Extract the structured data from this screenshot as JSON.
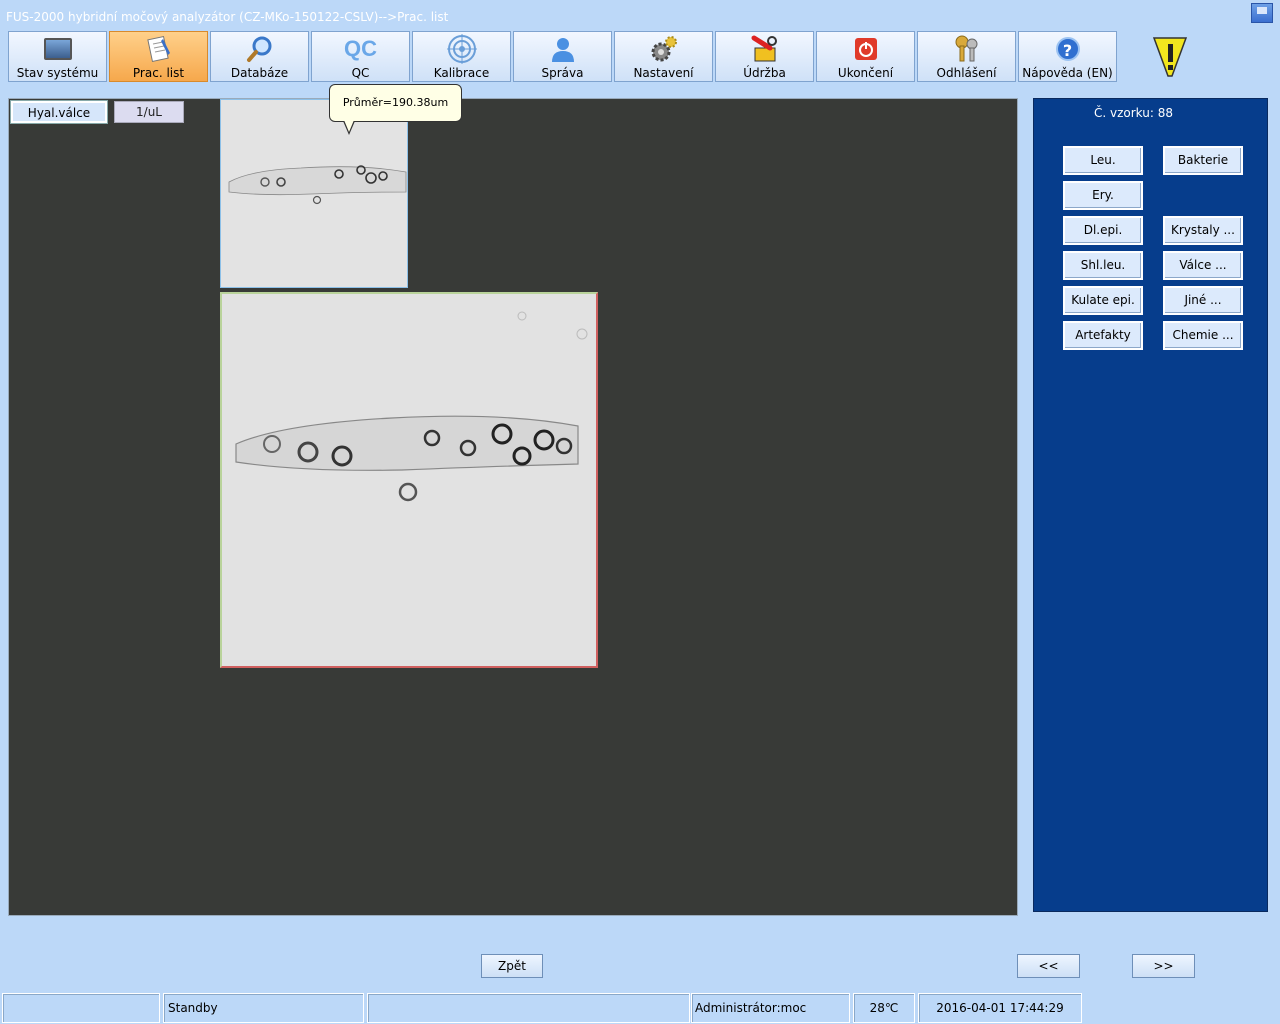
{
  "window": {
    "title": "FUS-2000 hybridní močový analyzátor (CZ-MKo-150122-CSLV)-->Prac. list"
  },
  "toolbar": {
    "items": [
      {
        "label": "Stav systému",
        "icon": "monitor-icon",
        "active": false
      },
      {
        "label": "Prac. list",
        "icon": "worklist-icon",
        "active": true
      },
      {
        "label": "Databáze",
        "icon": "magnifier-icon",
        "active": false
      },
      {
        "label": "QC",
        "icon": "qc-icon",
        "active": false
      },
      {
        "label": "Kalibrace",
        "icon": "target-icon",
        "active": false
      },
      {
        "label": "Správa",
        "icon": "user-icon",
        "active": false
      },
      {
        "label": "Nastavení",
        "icon": "gears-icon",
        "active": false
      },
      {
        "label": "Údržba",
        "icon": "toolbox-icon",
        "active": false
      },
      {
        "label": "Ukončení",
        "icon": "power-icon",
        "active": false
      },
      {
        "label": "Odhlášení",
        "icon": "keys-icon",
        "active": false
      },
      {
        "label": "Nápověda (EN)",
        "icon": "help-icon",
        "active": false
      }
    ],
    "qc_glyph": "QC",
    "help_glyph": "?"
  },
  "viewer": {
    "class_tag": "Hyal.válce",
    "unit_tag": "1/uL",
    "tooltip": "Průměr=190.38um"
  },
  "side": {
    "sample_label": "Č. vzorku: 88",
    "buttons": [
      {
        "label": "Leu."
      },
      {
        "label": "Bakterie"
      },
      {
        "label": "Ery."
      },
      {
        "label": "Dl.epi."
      },
      {
        "label": "Krystaly ..."
      },
      {
        "label": "Shl.leu."
      },
      {
        "label": "Válce ..."
      },
      {
        "label": "Kulate epi."
      },
      {
        "label": "Jiné ..."
      },
      {
        "label": "Artefakty"
      },
      {
        "label": "Chemie ..."
      }
    ]
  },
  "nav": {
    "back": "Zpět",
    "prev": "<<",
    "next": ">>"
  },
  "status": {
    "cell1": "",
    "state": "Standby",
    "cell3": "",
    "user": "Administrátor:moc",
    "temperature": "28℃",
    "datetime": "2016-04-01 17:44:29"
  },
  "colors": {
    "background": "#bcd8f8",
    "viewer_bg": "#383a37",
    "side_panel": "#063d8c",
    "active_tab": "#f6a84c"
  }
}
